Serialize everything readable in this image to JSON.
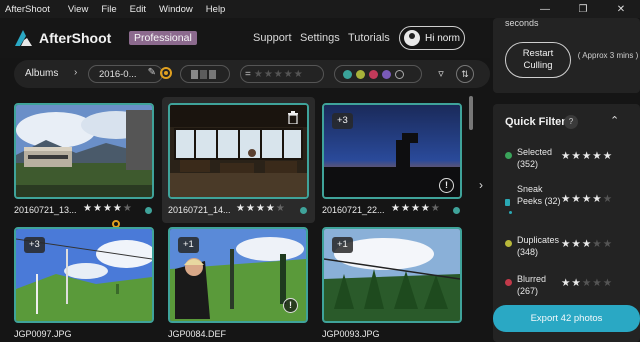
{
  "window": {
    "app_name": "AfterShoot",
    "menu": [
      "View",
      "File",
      "Edit",
      "Window",
      "Help"
    ]
  },
  "header": {
    "logo_text": "AfterShoot",
    "plan_badge": "Professional",
    "nav": [
      "Support",
      "Settings",
      "Tutorials"
    ],
    "user_label": "Hi norm"
  },
  "toolbar": {
    "albums_label": "Albums",
    "album_value": "2016-0...",
    "star_filter_prefix": "=",
    "color_filters": [
      "#3aa39a",
      "#a8b23a",
      "#c23a5a",
      "#7a5ab8"
    ]
  },
  "photos": [
    {
      "name": "20160721_13...",
      "rating": 4,
      "group_count": ""
    },
    {
      "name": "20160721_14...",
      "rating": 4,
      "group_count": ""
    },
    {
      "name": "20160721_22...",
      "rating": 4,
      "group_count": "+3"
    },
    {
      "name": "JGP0097.JPG",
      "rating": 0,
      "group_count": "+3"
    },
    {
      "name": "JGP0084.DEF",
      "rating": 0,
      "group_count": "+1"
    },
    {
      "name": "JGP0093.JPG",
      "rating": 0,
      "group_count": "+1"
    }
  ],
  "culling": {
    "seconds_text": "seconds",
    "restart_label_1": "Restart",
    "restart_label_2": "Culling",
    "approx_text": "( Approx 3 mins )"
  },
  "quick_filters": {
    "title": "Quick Filters",
    "help": "?",
    "items": [
      {
        "label_1": "Selected",
        "label_2": "(352)",
        "rating": 5,
        "color": "#3aa35a"
      },
      {
        "label_1": "Sneak",
        "label_2": "Peeks (32)",
        "rating": 4,
        "color": "#2aa8b4"
      },
      {
        "label_1": "Duplicates",
        "label_2": "(348)",
        "rating": 3,
        "color": "#b8b83a"
      },
      {
        "label_1": "Blurred",
        "label_2": "(267)",
        "rating": 2,
        "color": "#c23a4a"
      }
    ]
  },
  "export": {
    "label": "Export 42 photos"
  }
}
